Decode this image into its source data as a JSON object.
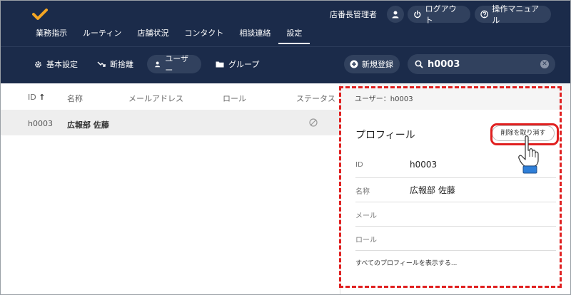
{
  "header": {
    "user_name": "店番長管理者",
    "logout_label": "ログアウト",
    "manual_label": "操作マニュアル"
  },
  "tabs": [
    {
      "label": "業務指示"
    },
    {
      "label": "ルーティン"
    },
    {
      "label": "店舗状況"
    },
    {
      "label": "コンタクト"
    },
    {
      "label": "相談連絡"
    },
    {
      "label": "設定",
      "active": true
    }
  ],
  "subnav": {
    "basic_settings": "基本設定",
    "abandoned": "断捨離",
    "users": "ユーザー",
    "groups": "グループ",
    "new_registration": "新規登録",
    "search_value": "h0003"
  },
  "table": {
    "headers": [
      "ID",
      "名称",
      "メールアドレス",
      "ロール",
      "ステータス"
    ],
    "sort_indicator": "↑",
    "rows": [
      {
        "id": "h0003",
        "name": "広報部 佐藤",
        "email": "",
        "role": "",
        "status_icon": "ban-icon"
      }
    ]
  },
  "panel": {
    "title": "ユーザー：h0003",
    "profile_heading": "プロフィール",
    "cancel_delete_label": "削除を取り消す",
    "fields": [
      {
        "label": "ID",
        "value": "h0003"
      },
      {
        "label": "名称",
        "value": "広報部 佐藤"
      },
      {
        "label": "メール",
        "value": ""
      },
      {
        "label": "ロール",
        "value": ""
      }
    ],
    "show_all_link": "すべてのプロフィールを表示する..."
  },
  "colors": {
    "header_bg": "#1b2b4a",
    "accent": "#f5a623",
    "annotation_red": "#e02020"
  }
}
